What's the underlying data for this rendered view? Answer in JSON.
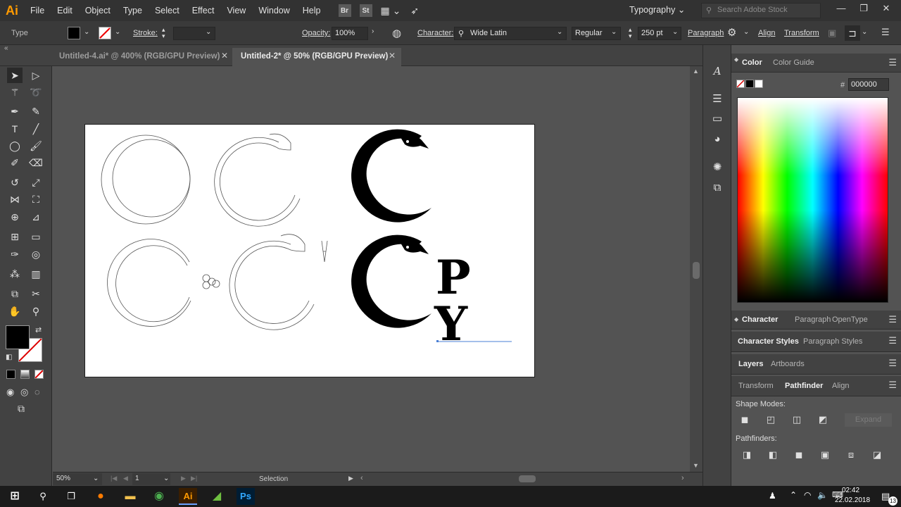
{
  "menubar": {
    "logo": "Ai",
    "items": [
      "File",
      "Edit",
      "Object",
      "Type",
      "Select",
      "Effect",
      "View",
      "Window",
      "Help"
    ],
    "bridge": "Br",
    "stock": "St",
    "workspace": "Typography",
    "search_placeholder": "Search Adobe Stock",
    "min": "—",
    "max": "❐",
    "close": "✕"
  },
  "controlbar": {
    "selection_type": "Type",
    "stroke_label": "Stroke:",
    "opacity_label": "Opacity:",
    "opacity_value": "100%",
    "character_label": "Character:",
    "font_family": "Wide Latin",
    "font_style": "Regular",
    "font_size": "250 pt",
    "paragraph_label": "Paragraph",
    "align_label": "Align",
    "transform_label": "Transform",
    "fill_color": "#000000"
  },
  "tabs": [
    {
      "label": "Untitled-4.ai* @ 400% (RGB/GPU Preview)"
    },
    {
      "label": "Untitled-2* @ 50% (RGB/GPU Preview)"
    }
  ],
  "artboard": {
    "text_p": "P",
    "text_y": "Y"
  },
  "panels": {
    "color": {
      "tab1": "Color",
      "tab2": "Color Guide",
      "hex_label": "#",
      "hex_value": "000000"
    },
    "character": {
      "tab1": "Character",
      "tab2": "Paragraph",
      "tab3": "OpenType"
    },
    "styles": {
      "tab1": "Character Styles",
      "tab2": "Paragraph Styles"
    },
    "layers": {
      "tab1": "Layers",
      "tab2": "Artboards"
    },
    "pathfinder": {
      "tab1": "Transform",
      "tab2": "Pathfinder",
      "tab3": "Align",
      "shape_modes": "Shape Modes:",
      "expand": "Expand",
      "pathfinders": "Pathfinders:"
    }
  },
  "statusbar": {
    "zoom": "50%",
    "artboard_number": "1",
    "tool_name": "Selection"
  },
  "taskbar": {
    "time": "02:42",
    "date": "22.02.2018",
    "notifications": "13",
    "ai": "Ai",
    "ps": "Ps"
  }
}
